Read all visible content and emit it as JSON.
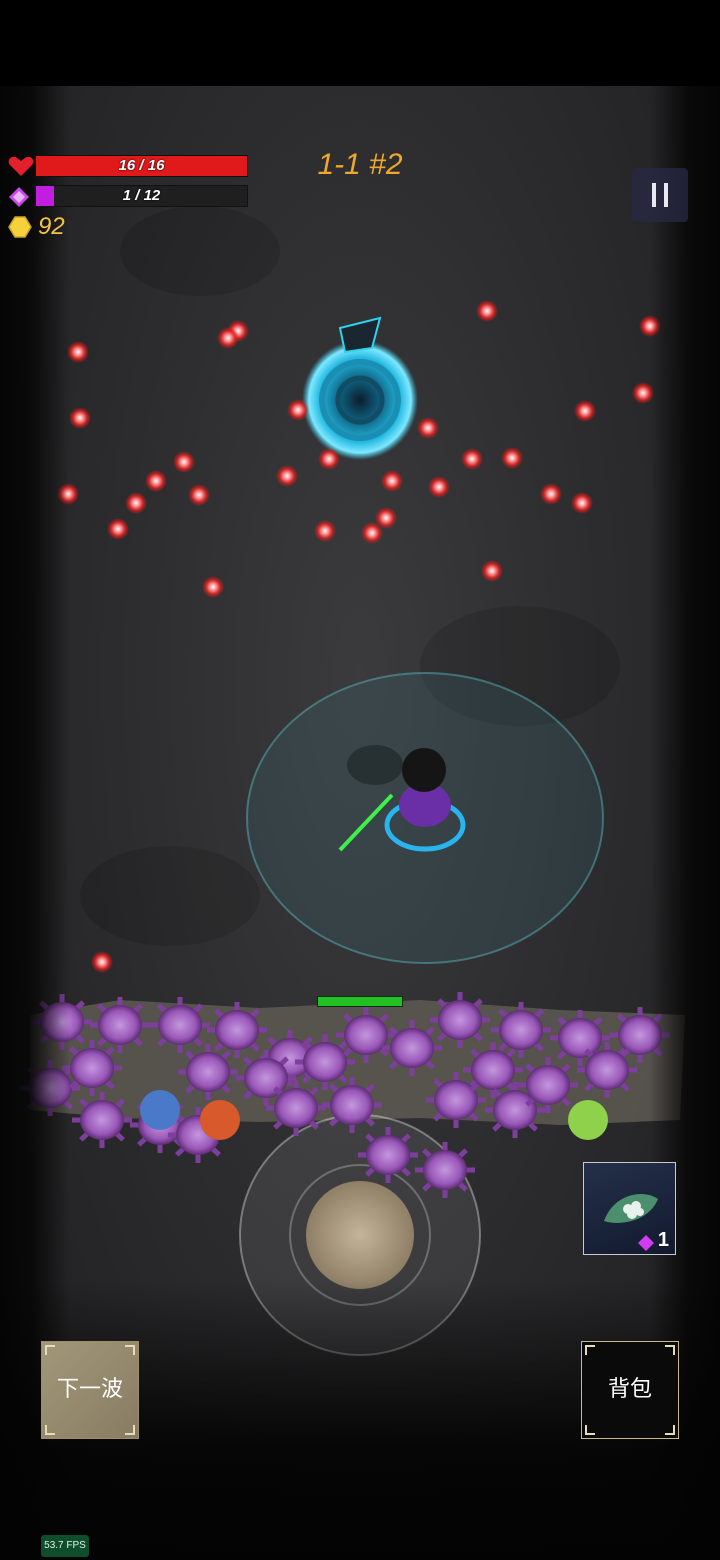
{
  "hud": {
    "health_text": "16 / 16",
    "health_fraction": 1.0,
    "mana_text": "1 / 12",
    "mana_fraction": 0.0833,
    "gold": "92",
    "stage": "1-1 #2"
  },
  "icons": {
    "health": "heart-icon",
    "mana": "gem-icon",
    "gold": "gold-coin-icon",
    "pause": "pause-icon",
    "item": "leaf-seeds-icon",
    "item_cost": "gem-icon"
  },
  "item_slot": {
    "count": "1"
  },
  "buttons": {
    "next_wave": "下一波",
    "bag": "背包"
  },
  "fps": "53.7 FPS",
  "wall_health_fraction": 1.0,
  "colors": {
    "health_fill": "#e01a1a",
    "mana_fill": "#c21ee0",
    "gold": "#f4c542",
    "stage": "#f0a72a",
    "portal": "#27c3e6",
    "enemy": "#9a58b8",
    "wall_health": "#22c022"
  }
}
